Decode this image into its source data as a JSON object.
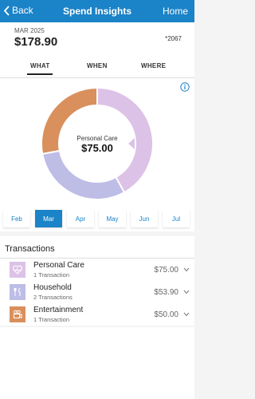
{
  "navbar": {
    "back_label": "Back",
    "title": "Spend Insights",
    "home_label": "Home"
  },
  "summary": {
    "period": "MAR 2025",
    "total": "$178.90",
    "card": "*2067"
  },
  "tabs": [
    {
      "label": "WHAT",
      "active": true
    },
    {
      "label": "WHEN",
      "active": false
    },
    {
      "label": "WHERE",
      "active": false
    }
  ],
  "chart": {
    "center_label": "Personal Care",
    "center_value": "$75.00",
    "colors": {
      "personal_care": "#dcc2e6",
      "household": "#bdbde6",
      "entertainment": "#d9905c"
    }
  },
  "chart_data": {
    "type": "pie",
    "labels": [
      "Personal Care",
      "Household",
      "Entertainment"
    ],
    "values": [
      75.0,
      53.9,
      50.0
    ]
  },
  "months": [
    {
      "label": "Feb",
      "active": false
    },
    {
      "label": "Mar",
      "active": true
    },
    {
      "label": "Apr",
      "active": false
    },
    {
      "label": "May",
      "active": false
    },
    {
      "label": "Jun",
      "active": false
    },
    {
      "label": "Jul",
      "active": false
    }
  ],
  "transactions": {
    "title": "Transactions",
    "items": [
      {
        "name": "Personal Care",
        "count": "1 Transaction",
        "amount": "$75.00",
        "icon": "heart-pulse-icon",
        "color": "#dcc2e6"
      },
      {
        "name": "Household",
        "count": "2 Transactions",
        "amount": "$53.90",
        "icon": "fork-knife-icon",
        "color": "#bdbde6"
      },
      {
        "name": "Entertainment",
        "count": "1 Transaction",
        "amount": "$50.00",
        "icon": "film-camera-icon",
        "color": "#d9905c"
      }
    ]
  }
}
